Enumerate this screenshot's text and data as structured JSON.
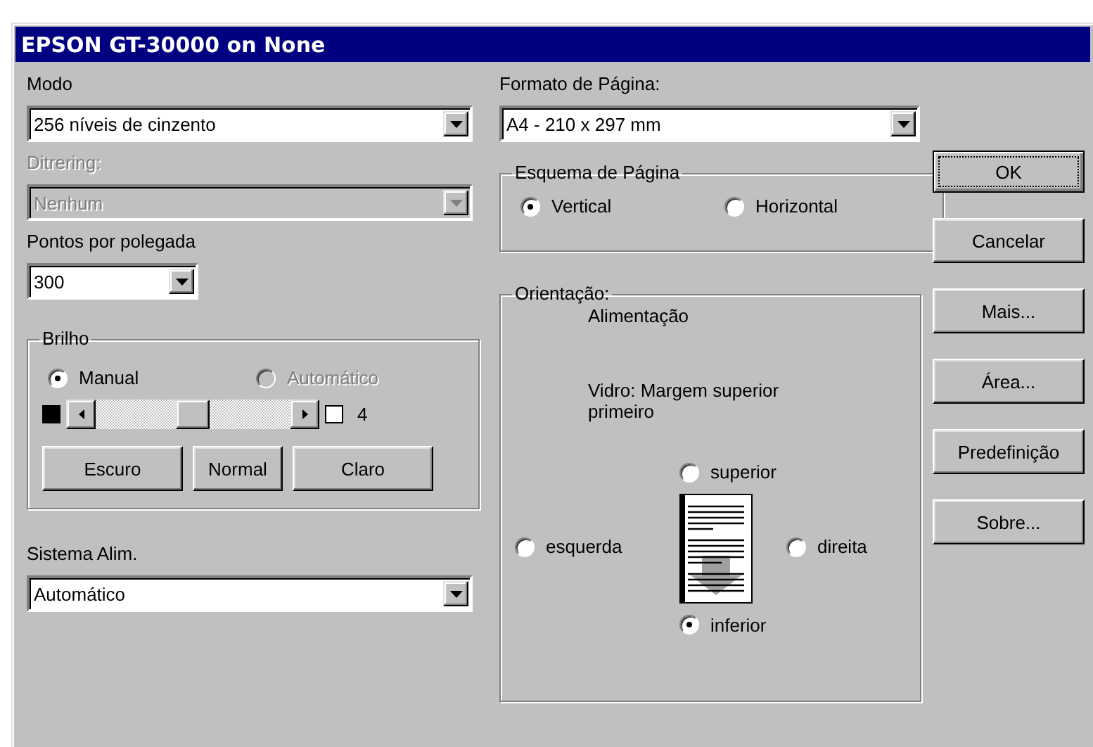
{
  "window": {
    "title": "EPSON GT-30000 on None"
  },
  "left": {
    "mode": {
      "label": "Modo",
      "value": "256 níveis de cinzento",
      "disabled": false
    },
    "dithering": {
      "label": "Ditrering:",
      "value": "Nenhum",
      "disabled": true
    },
    "dpi": {
      "label": "Pontos por polegada",
      "value": "300",
      "disabled": false
    },
    "brightness": {
      "title": "Brilho",
      "options": [
        {
          "label": "Manual",
          "selected": true,
          "disabled": false
        },
        {
          "label": "Automático",
          "selected": false,
          "disabled": true
        }
      ],
      "slider": {
        "level": 0.5,
        "reading": "4"
      },
      "buttons": [
        "Escuro",
        "Normal",
        "Claro"
      ]
    },
    "feed": {
      "label": "Sistema Alim.",
      "value": "Automático",
      "disabled": false
    }
  },
  "middle": {
    "page_format": {
      "label": "Formato de Página:",
      "value": "A4 - 210 x 297 mm",
      "disabled": false
    },
    "layout": {
      "title": "Esquema de Página",
      "options": [
        {
          "label": "Vertical",
          "selected": true
        },
        {
          "label": "Horizontal",
          "selected": false
        }
      ]
    },
    "orientation": {
      "title": "Orientação:",
      "heading": "Alimentação",
      "note": "Vidro: Margem superior primeiro",
      "options": [
        {
          "label": "superior",
          "kind": "top",
          "selected": false
        },
        {
          "label": "esquerda",
          "kind": "left",
          "selected": false
        },
        {
          "label": "direita",
          "kind": "right",
          "selected": false
        },
        {
          "label": "inferior",
          "kind": "bottom",
          "selected": true
        }
      ]
    }
  },
  "buttons": [
    {
      "label": "OK",
      "default": true
    },
    {
      "label": "Cancelar",
      "default": false
    },
    {
      "label": "Mais...",
      "default": false
    },
    {
      "label": "Área...",
      "default": false
    },
    {
      "label": "Predefinição",
      "default": false
    },
    {
      "label": "Sobre...",
      "default": false
    }
  ]
}
